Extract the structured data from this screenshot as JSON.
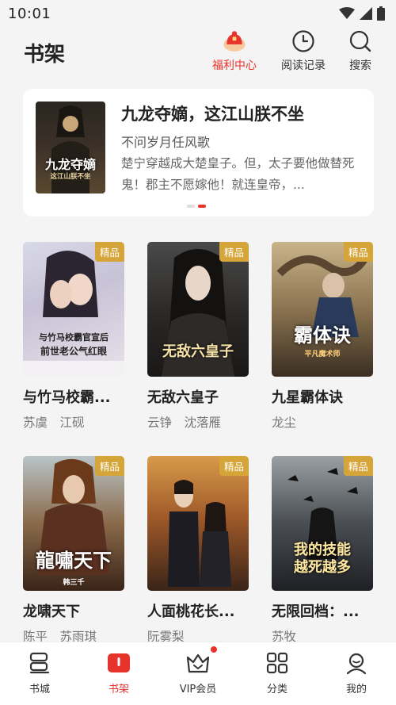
{
  "status": {
    "time": "10:01"
  },
  "header": {
    "title": "书架",
    "welfare_label": "福利中心",
    "history_label": "阅读记录",
    "search_label": "搜索"
  },
  "hero": {
    "title": "九龙夺嫡，这江山朕不坐",
    "author": "不问岁月任风歌",
    "description": "楚宁穿越成大楚皇子。但，太子要他做替死鬼！郡主不愿嫁他！就连皇帝，...",
    "cover_text": "九龙夺嫡",
    "cover_subtext": "这江山朕不坐"
  },
  "books": [
    {
      "title": "与竹马校霸...",
      "author": "苏虞　江砚",
      "badge": "精品",
      "cover_text": "与竹马校霸官宣后",
      "cover_text2": "前世老公气红眼"
    },
    {
      "title": "无敌六皇子",
      "author": "云铮　沈落雁",
      "badge": "精品",
      "cover_text": "无敌六皇子",
      "cover_text2": ""
    },
    {
      "title": "九星霸体诀",
      "author": "龙尘",
      "badge": "精品",
      "cover_text": "霸体诀",
      "cover_text2": "平凡魔术师"
    },
    {
      "title": "龙啸天下",
      "author": "陈平　苏雨琪",
      "badge": "精品",
      "cover_text": "龍嘯天下",
      "cover_text2": "韩三千"
    },
    {
      "title": "人面桃花长...",
      "author": "阮雾梨",
      "badge": "精品",
      "cover_text": "",
      "cover_text2": ""
    },
    {
      "title": "无限回档：...",
      "author": "苏牧",
      "badge": "精品",
      "cover_text": "我的技能",
      "cover_text2": "越死越多"
    }
  ],
  "tabs": [
    {
      "label": "书城"
    },
    {
      "label": "书架"
    },
    {
      "label": "VIP会员"
    },
    {
      "label": "分类"
    },
    {
      "label": "我的"
    }
  ],
  "colors": {
    "accent": "#e8322c",
    "badge": "#d6a53a"
  }
}
